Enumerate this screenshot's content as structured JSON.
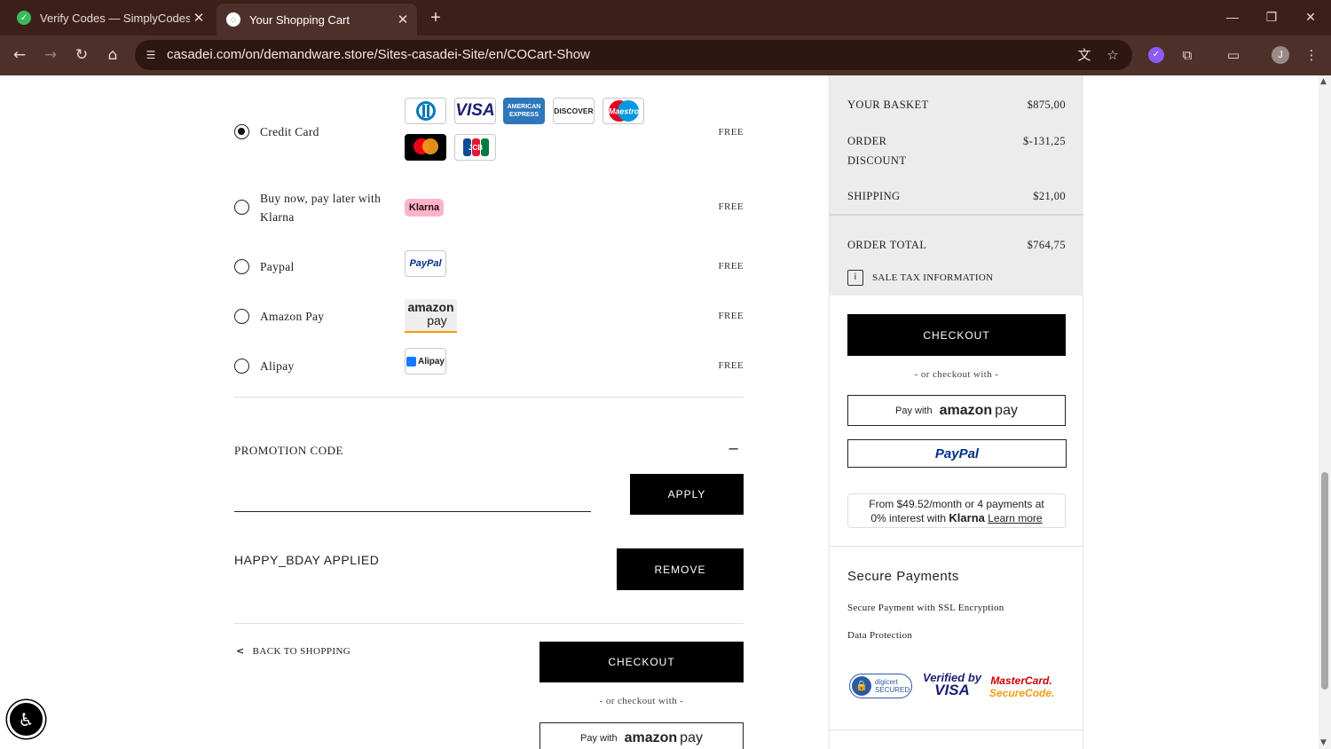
{
  "browser": {
    "tabs": [
      {
        "title": "Verify Codes — SimplyCodes",
        "favicon": "check-icon",
        "active": false
      },
      {
        "title": "Your Shopping Cart",
        "favicon": "spinner-icon",
        "active": true
      }
    ],
    "url": "casadei.com/on/demandware.store/Sites-casadei-Site/en/COCart-Show",
    "profile_initial": "J"
  },
  "payment_methods": [
    {
      "label": "Credit Card",
      "price": "FREE",
      "selected": true
    },
    {
      "label": "Buy now, pay later with Klarna",
      "price": "FREE",
      "selected": false
    },
    {
      "label": "Paypal",
      "price": "FREE",
      "selected": false
    },
    {
      "label": "Amazon Pay",
      "price": "FREE",
      "selected": false
    },
    {
      "label": "Alipay",
      "price": "FREE",
      "selected": false
    }
  ],
  "card_logos": {
    "visa": "VISA",
    "amex_line1": "AMERICAN",
    "amex_line2": "EXPRESS",
    "discover": "DISCOVER",
    "maestro": "Maestro",
    "jcb": "JCB",
    "klarna": "Klarna",
    "paypal": "PayPal",
    "amazon_word": "amazon",
    "amazon_pay": "pay",
    "alipay": "Alipay"
  },
  "promotion": {
    "title": "PROMOTION CODE",
    "toggle": "−",
    "input_value": "",
    "apply_label": "APPLY",
    "applied_text": "HAPPY_BDAY APPLIED",
    "remove_label": "REMOVE"
  },
  "bottom": {
    "back_label": "BACK TO SHOPPING",
    "checkout_label": "CHECKOUT",
    "or_text": "- or checkout with -",
    "pay_with": "Pay with",
    "amazon_word": "amazon",
    "amazon_pay": "pay"
  },
  "summary": {
    "basket_label": "YOUR BASKET",
    "basket_value": "$875,00",
    "discount_label_1": "ORDER",
    "discount_label_2": "DISCOUNT",
    "discount_value": "$-131,25",
    "shipping_label": "SHIPPING",
    "shipping_value": "$21,00",
    "total_label": "ORDER TOTAL",
    "total_value": "$764,75",
    "tax_info": "SALE TAX INFORMATION",
    "checkout_label": "CHECKOUT",
    "or_text": "- or checkout with -",
    "pay_with": "Pay with",
    "amazon_word": "amazon",
    "amazon_pay": "pay",
    "paypal": "PayPal",
    "klarna_line1": "From $49.52/month or 4 payments at",
    "klarna_line2_pre": "0% interest with",
    "klarna_brand": "Klarna",
    "klarna_learn": "Learn more"
  },
  "secure": {
    "title": "Secure Payments",
    "items": [
      "Secure Payment with SSL Encryption",
      "Data Protection"
    ],
    "badges": {
      "digicert_1": "digicert",
      "digicert_2": "SECURED",
      "verified_1": "Verified by",
      "verified_2": "VISA",
      "mastercard_1": "MasterCard.",
      "mastercard_2": "SecureCode."
    }
  },
  "colors": {
    "chrome_dark": "#3c1f1b",
    "chrome": "#4e302b",
    "summary_bg": "#ececec",
    "button": "#000000"
  }
}
